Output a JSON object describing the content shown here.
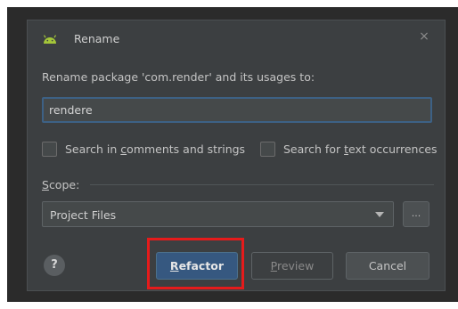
{
  "dialog": {
    "title": "Rename",
    "close_glyph": "×",
    "prompt": "Rename package 'com.render' and its usages to:",
    "name_value": "rendere"
  },
  "options": {
    "search_comments": {
      "pre": "Search in ",
      "mnemonic": "c",
      "post": "omments and strings",
      "checked": false
    },
    "search_text": {
      "pre": "Search for ",
      "mnemonic": "t",
      "post": "ext occurrences",
      "checked": false
    }
  },
  "scope": {
    "label_mnemonic": "S",
    "label_rest": "cope:",
    "selected": "Project Files",
    "browse_label": "..."
  },
  "buttons": {
    "help": "?",
    "refactor": {
      "mnemonic": "R",
      "rest": "efactor"
    },
    "preview": {
      "mnemonic": "P",
      "rest": "review"
    },
    "cancel": "Cancel"
  },
  "icons": {
    "title_icon": "android-icon",
    "dropdown": "chevron-down-icon"
  },
  "colors": {
    "dialog_bg": "#3c3f41",
    "field_focus_border": "#3d6185",
    "primary_button": "#365880",
    "android_green": "#a4c639",
    "highlight": "#e51b1b"
  }
}
